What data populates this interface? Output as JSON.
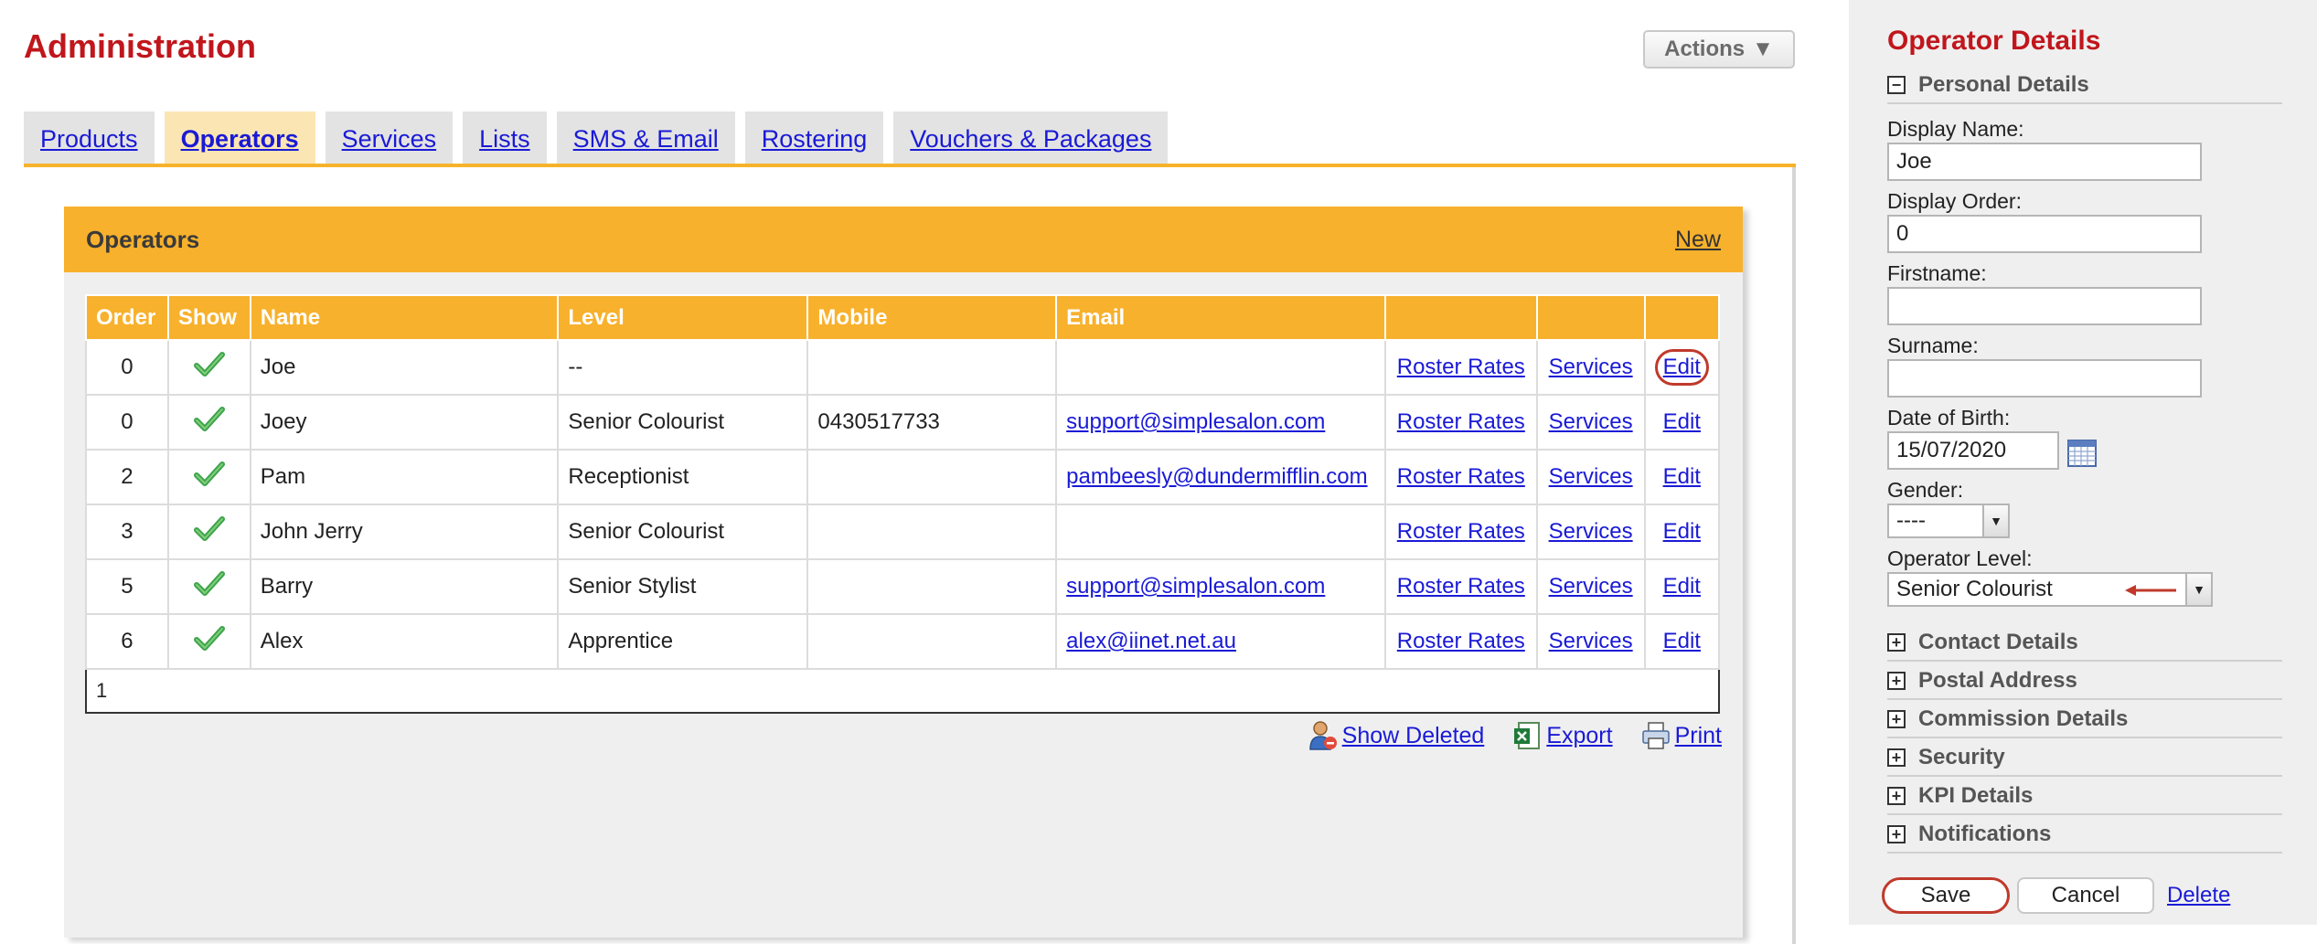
{
  "main": {
    "title": "Administration",
    "actions_label": "Actions",
    "tabs": [
      {
        "label": "Products"
      },
      {
        "label": "Operators"
      },
      {
        "label": "Services"
      },
      {
        "label": "Lists"
      },
      {
        "label": "SMS & Email"
      },
      {
        "label": "Rostering"
      },
      {
        "label": "Vouchers & Packages"
      }
    ],
    "active_tab": "Operators",
    "panel_title": "Operators",
    "new_label": "New",
    "table": {
      "headers": [
        "Order",
        "Show",
        "Name",
        "Level",
        "Mobile",
        "Email",
        "",
        "",
        ""
      ],
      "rows": [
        {
          "order": "0",
          "name": "Joe",
          "level": "--",
          "mobile": "",
          "email": "",
          "roster": "Roster Rates",
          "services": "Services",
          "edit": "Edit"
        },
        {
          "order": "0",
          "name": "Joey",
          "level": "Senior Colourist",
          "mobile": "0430517733",
          "email": "support@simplesalon.com",
          "roster": "Roster Rates",
          "services": "Services",
          "edit": "Edit"
        },
        {
          "order": "2",
          "name": "Pam",
          "level": "Receptionist",
          "mobile": "",
          "email": "pambeesly@dundermifflin.com",
          "roster": "Roster Rates",
          "services": "Services",
          "edit": "Edit"
        },
        {
          "order": "3",
          "name": "John Jerry",
          "level": "Senior Colourist",
          "mobile": "",
          "email": "",
          "roster": "Roster Rates",
          "services": "Services",
          "edit": "Edit"
        },
        {
          "order": "5",
          "name": "Barry",
          "level": "Senior Stylist",
          "mobile": "",
          "email": "support@simplesalon.com",
          "roster": "Roster Rates",
          "services": "Services",
          "edit": "Edit"
        },
        {
          "order": "6",
          "name": "Alex",
          "level": "Apprentice",
          "mobile": "",
          "email": "alex@iinet.net.au",
          "roster": "Roster Rates",
          "services": "Services",
          "edit": "Edit"
        }
      ],
      "page": "1"
    },
    "footer": {
      "show_deleted": "Show Deleted",
      "export": "Export",
      "print": "Print"
    }
  },
  "sidebar": {
    "title": "Operator Details",
    "personal_section": "Personal Details",
    "display_name_label": "Display Name:",
    "display_name_value": "Joe",
    "display_order_label": "Display Order:",
    "display_order_value": "0",
    "firstname_label": "Firstname:",
    "firstname_value": "",
    "surname_label": "Surname:",
    "surname_value": "",
    "dob_label": "Date of Birth:",
    "dob_value": "15/07/2020",
    "gender_label": "Gender:",
    "gender_value": "----",
    "level_label": "Operator Level:",
    "level_value": "Senior Colourist",
    "sections": [
      {
        "label": "Contact Details"
      },
      {
        "label": "Postal Address"
      },
      {
        "label": "Commission Details"
      },
      {
        "label": "Security"
      },
      {
        "label": "KPI Details"
      },
      {
        "label": "Notifications"
      }
    ],
    "save_label": "Save",
    "cancel_label": "Cancel",
    "delete_label": "Delete"
  },
  "colors": {
    "accent": "#f8b12c",
    "title_red": "#c0161c",
    "link": "#1a1ad6",
    "highlight_circle": "#c0392b"
  }
}
